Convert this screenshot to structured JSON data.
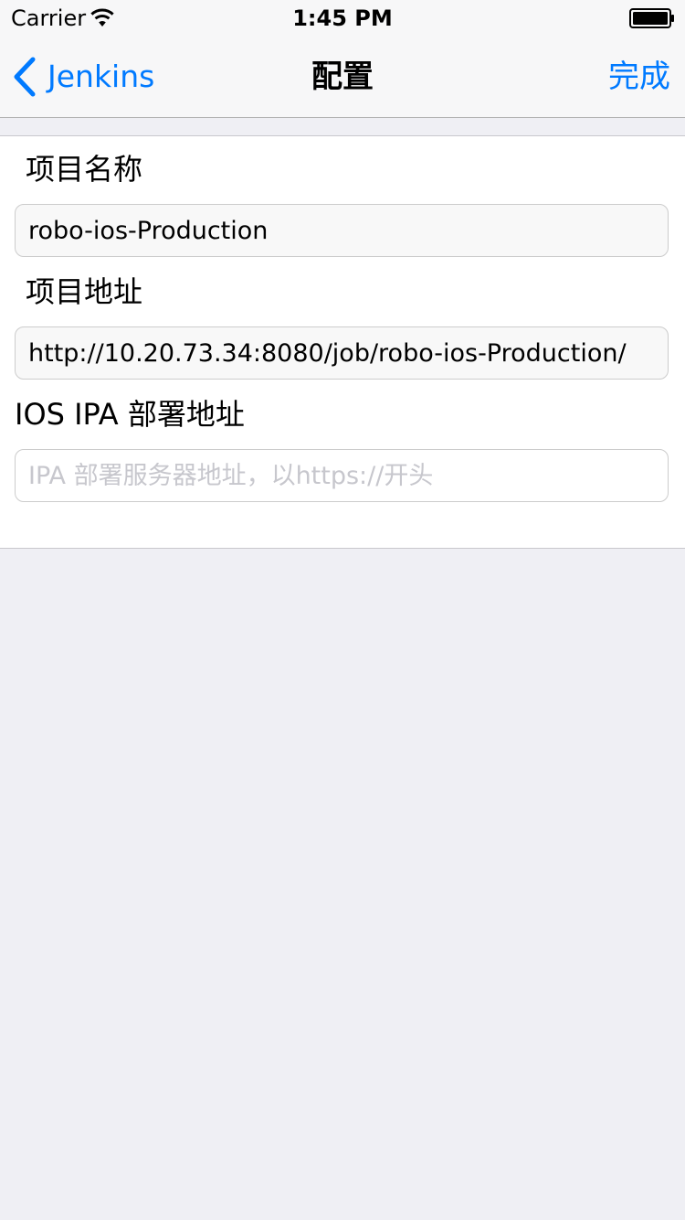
{
  "status_bar": {
    "carrier": "Carrier",
    "time": "1:45 PM",
    "wifi_icon": "wifi-icon",
    "battery_icon": "battery-icon"
  },
  "nav": {
    "back_label": "Jenkins",
    "back_icon": "chevron-left-icon",
    "title": "配置",
    "done_label": "完成"
  },
  "form": {
    "project_name_label": "项目名称",
    "project_name_value": "robo-ios-Production",
    "project_url_label": "项目地址",
    "project_url_value": "http://10.20.73.34:8080/job/robo-ios-Production/",
    "ipa_url_label": "IOS IPA 部署地址",
    "ipa_url_value": "",
    "ipa_url_placeholder": "IPA 部署服务器地址，以https://开头"
  },
  "colors": {
    "accent": "#007aff",
    "background": "#efeff4",
    "nav_background": "#f7f7f8",
    "placeholder": "#c7c7cd"
  }
}
